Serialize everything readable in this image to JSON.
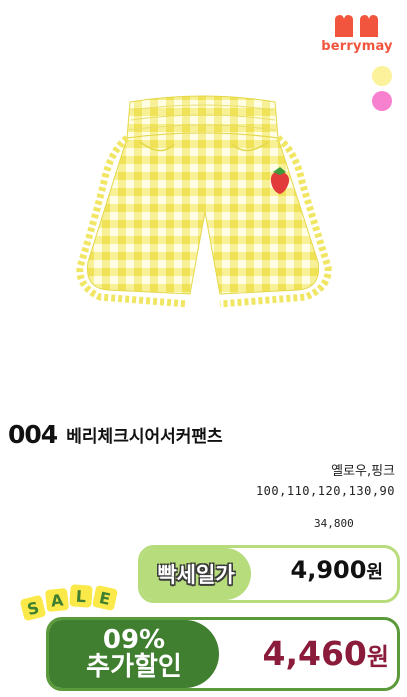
{
  "brand": {
    "name": "berrymay",
    "accent": "#f1553d"
  },
  "color_swatches": [
    {
      "name": "yellow",
      "hex": "#fbf29b"
    },
    {
      "name": "pink",
      "hex": "#f780cf"
    }
  ],
  "product": {
    "number": "004",
    "name": "베리체크시어서커팬츠",
    "colors": "옐로우,핑크",
    "sizes": "100,110,120,130,90",
    "original_price": "34,800"
  },
  "sale": {
    "label": "빡세일가",
    "price": "4,900",
    "currency": "원"
  },
  "discount": {
    "sticker": [
      "S",
      "A",
      "L",
      "E"
    ],
    "percent": "09%",
    "label": "추가할인",
    "price": "4,460",
    "currency": "원"
  }
}
